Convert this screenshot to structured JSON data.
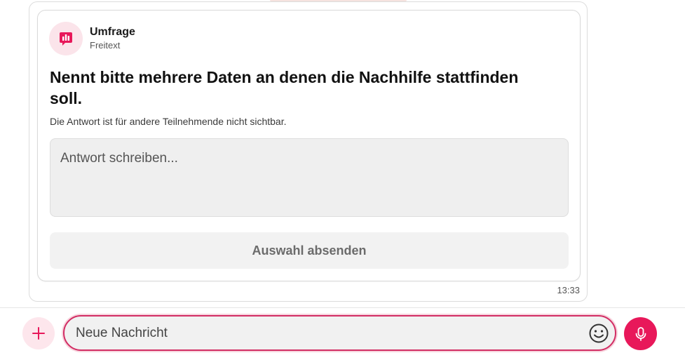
{
  "poll": {
    "type_label": "Umfrage",
    "subtype_label": "Freitext",
    "question": "Nennt bitte mehrere Daten an denen die Nachhilfe stattfinden soll.",
    "note": "Die Antwort ist für andere Teilnehmende nicht sichtbar.",
    "answer_placeholder": "Antwort schreiben...",
    "answer_value": "",
    "submit_label": "Auswahl absenden",
    "icon": "poll-chart-icon"
  },
  "message": {
    "timestamp": "13:33"
  },
  "composer": {
    "placeholder": "Neue Nachricht",
    "value": "",
    "add_icon": "plus-icon",
    "emoji_icon": "smiley-icon",
    "mic_icon": "microphone-icon"
  },
  "colors": {
    "accent": "#e8185a",
    "accent_light": "#fde6ec",
    "input_border": "#d22d64",
    "button_bg": "#f2f2f2",
    "input_bg": "#efefef"
  }
}
